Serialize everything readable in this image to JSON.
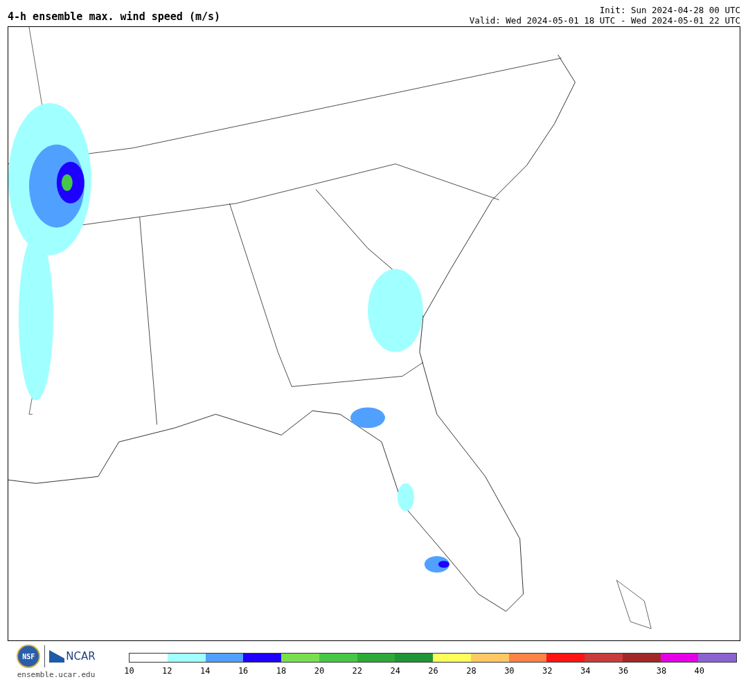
{
  "title": "4-h ensemble max. wind speed (m/s)",
  "init": "Init: Sun 2024-04-28 00 UTC",
  "valid": "Valid: Wed 2024-05-01 18 UTC - Wed 2024-05-01 22 UTC",
  "logos": {
    "nsf": "NSF",
    "ncar": "NCAR",
    "site": "ensemble.ucar.edu"
  },
  "colorbar": [
    {
      "label": "10",
      "color": "#ffffff"
    },
    {
      "label": "12",
      "color": "#a0ffff"
    },
    {
      "label": "14",
      "color": "#50a0ff"
    },
    {
      "label": "16",
      "color": "#1e00ff"
    },
    {
      "label": "18",
      "color": "#78e050"
    },
    {
      "label": "20",
      "color": "#46c846"
    },
    {
      "label": "22",
      "color": "#2daa37"
    },
    {
      "label": "24",
      "color": "#1e9637"
    },
    {
      "label": "26",
      "color": "#ffff5a"
    },
    {
      "label": "28",
      "color": "#ffc864"
    },
    {
      "label": "30",
      "color": "#ff8246"
    },
    {
      "label": "32",
      "color": "#ff1414"
    },
    {
      "label": "34",
      "color": "#c83c3c"
    },
    {
      "label": "36",
      "color": "#a02828"
    },
    {
      "label": "38",
      "color": "#e600e6"
    },
    {
      "label": "40",
      "color": "#8c64d2"
    }
  ]
}
